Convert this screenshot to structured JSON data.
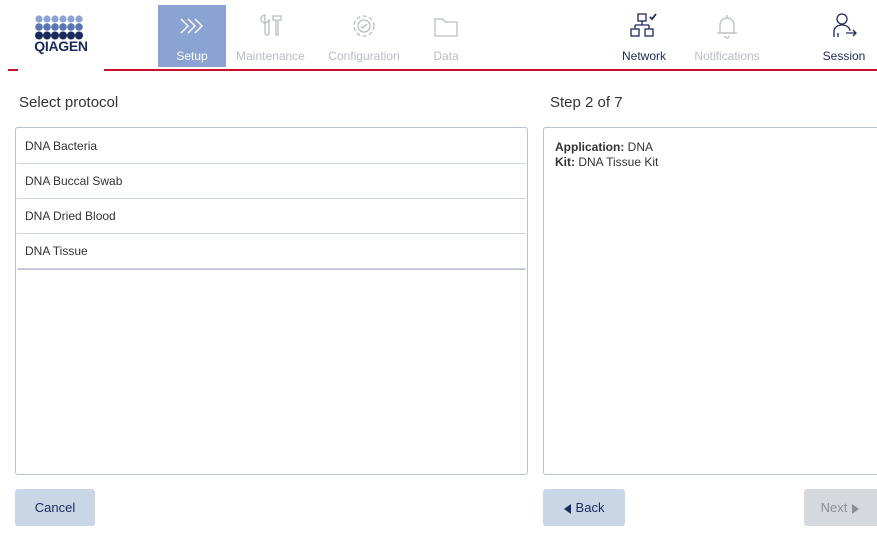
{
  "brand": {
    "logo_text": "QIAGEN"
  },
  "colors": {
    "accent": "#c8102e",
    "active_tab": "#8aa3d3",
    "navy": "#1a2a5e",
    "button_blue": "#c9d6e5",
    "disabled": "#d5d8dc"
  },
  "nav": {
    "tabs": [
      {
        "label": "Setup",
        "icon": "chevrons-icon",
        "state": "active"
      },
      {
        "label": "Maintenance",
        "icon": "tools-icon",
        "state": "disabled"
      },
      {
        "label": "Configuration",
        "icon": "gear-icon",
        "state": "disabled"
      },
      {
        "label": "Data",
        "icon": "folder-icon",
        "state": "disabled"
      }
    ],
    "right": [
      {
        "label": "Network",
        "icon": "network-connected-icon",
        "state": "enabled"
      },
      {
        "label": "Notifications",
        "icon": "bell-icon",
        "state": "disabled"
      },
      {
        "label": "Session",
        "icon": "user-logout-icon",
        "state": "enabled"
      }
    ]
  },
  "left": {
    "title": "Select protocol",
    "protocols": [
      "DNA Bacteria",
      "DNA Buccal Swab",
      "DNA Dried Blood",
      "DNA Tissue"
    ]
  },
  "right_panel": {
    "title": "Step 2 of 7",
    "application_label": "Application:",
    "application_value": "DNA",
    "kit_label": "Kit:",
    "kit_value": "DNA Tissue Kit"
  },
  "buttons": {
    "cancel": "Cancel",
    "back": "Back",
    "next": "Next"
  }
}
